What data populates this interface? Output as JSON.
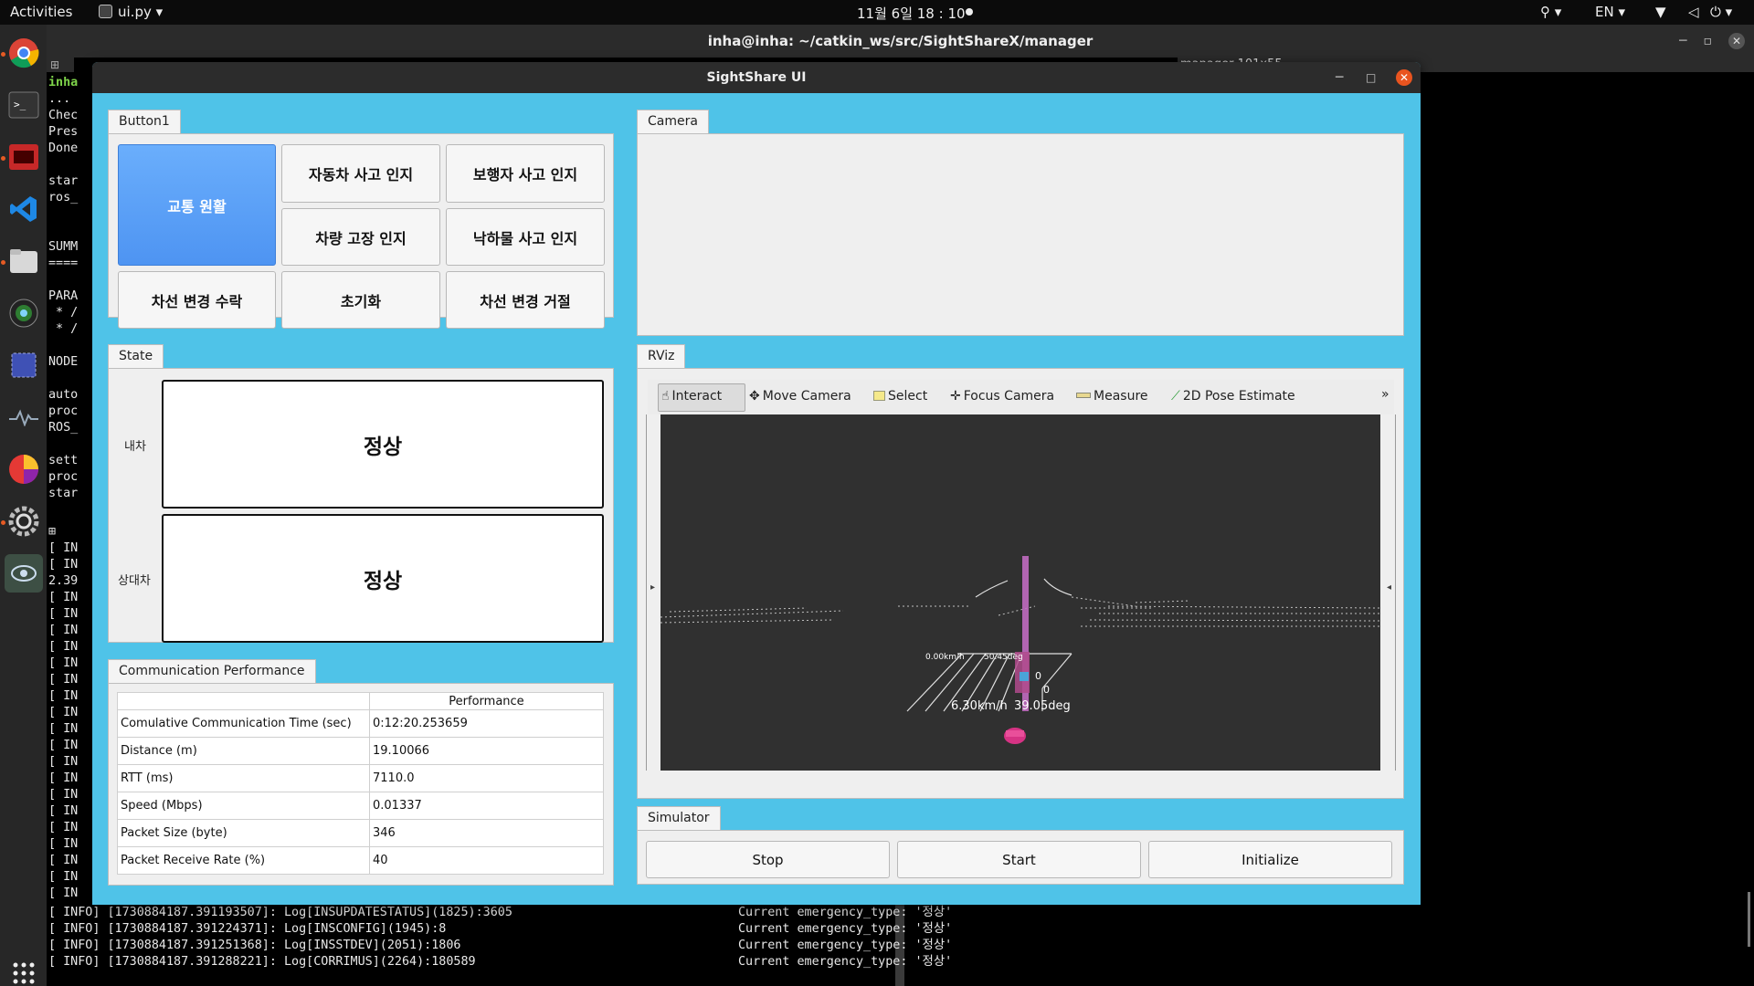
{
  "topbar": {
    "activities": "Activities",
    "app": "ui.py ▾",
    "clock": "11월 6일  18 : 10",
    "lang": "EN ▾",
    "access": "⚲ ▾",
    "net": "▼",
    "vol": "◁",
    "power": "⏻ ▾"
  },
  "dock": {
    "icons": [
      "chrome-icon",
      "terminal-icon",
      "red-app-icon",
      "vscode-icon",
      "files-icon",
      "camera-icon",
      "screenshot-icon",
      "monitor-icon",
      "pie-icon",
      "settings-icon",
      "eye-icon",
      "apps-grid-icon"
    ]
  },
  "terminal": {
    "title": "inha@inha: ~/catkin_ws/src/SightShareX/manager",
    "right_pane_title": "manager 101x55",
    "left_lines_top": [
      "inha",
      "...",
      "Chec",
      "Pres",
      "Done",
      "",
      "star",
      "ros_",
      "",
      "",
      "SUMM",
      "====",
      "",
      "PARA",
      " * /",
      " * /",
      "",
      "NODE",
      "",
      "auto",
      "proc",
      "ROS_",
      "",
      "sett",
      "proc",
      "star"
    ],
    "left_lines_bottom": [
      "[ IN",
      "[ IN",
      "2.39",
      "[ IN",
      "[ IN",
      "[ IN",
      "[ IN",
      "[ IN",
      "[ IN",
      "[ IN",
      "[ IN",
      "[ IN",
      "[ IN",
      "[ IN",
      "[ IN",
      "[ IN",
      "[ IN",
      "[ IN",
      "[ IN",
      "[ IN",
      "[ IN",
      "[ IN"
    ],
    "log_lines": [
      "[ INFO] [1730884187.391193507]: Log[INSUPDATESTATUS](1825):3605",
      "[ INFO] [1730884187.391224371]: Log[INSCONFIG](1945):8",
      "[ INFO] [1730884187.391251368]: Log[INSSTDEV](2051):1806",
      "[ INFO] [1730884187.391288221]: Log[CORRIMUS](2264):180589"
    ],
    "right_lines": [
      "Current emergency_type: '정상'",
      "Current emergency_type: '정상'",
      "Current emergency_type: '정상'",
      "Current emergency_type: '정상'"
    ]
  },
  "app": {
    "title": "SightShare UI",
    "button_panel": {
      "tab": "Button1",
      "buttons": [
        "교통 원활",
        "자동차 사고 인지",
        "보행자 사고 인지",
        "차량 고장 인지",
        "낙하물 사고 인지",
        "차선 변경 수락",
        "초기화",
        "차선 변경 거절"
      ]
    },
    "state_panel": {
      "tab": "State",
      "ego_label": "내차",
      "ego_state": "정상",
      "other_label": "상대차",
      "other_state": "정상"
    },
    "comm_panel": {
      "tab": "Communication Performance",
      "header": "Performance",
      "rows": [
        {
          "k": "Comulative Communication Time (sec)",
          "v": "0:12:20.253659"
        },
        {
          "k": "Distance (m)",
          "v": "19.10066"
        },
        {
          "k": "RTT (ms)",
          "v": "7110.0"
        },
        {
          "k": "Speed (Mbps)",
          "v": "0.01337"
        },
        {
          "k": "Packet Size (byte)",
          "v": "346"
        },
        {
          "k": "Packet Receive Rate (%)",
          "v": "40"
        }
      ]
    },
    "camera_panel": {
      "tab": "Camera"
    },
    "rviz_panel": {
      "tab": "RViz",
      "tools": [
        "Interact",
        "Move Camera",
        "Select",
        "Focus Camera",
        "Measure",
        "2D Pose Estimate"
      ],
      "overflow": "»",
      "view_labels": {
        "speed1": "6.30km/h",
        "deg1": "39.05deg",
        "speed2": "0.00km/h",
        "deg2": "50.45deg",
        "zero1": "0",
        "zero2": "0"
      }
    },
    "simulator_panel": {
      "tab": "Simulator",
      "buttons": [
        "Stop",
        "Start",
        "Initialize"
      ]
    }
  }
}
